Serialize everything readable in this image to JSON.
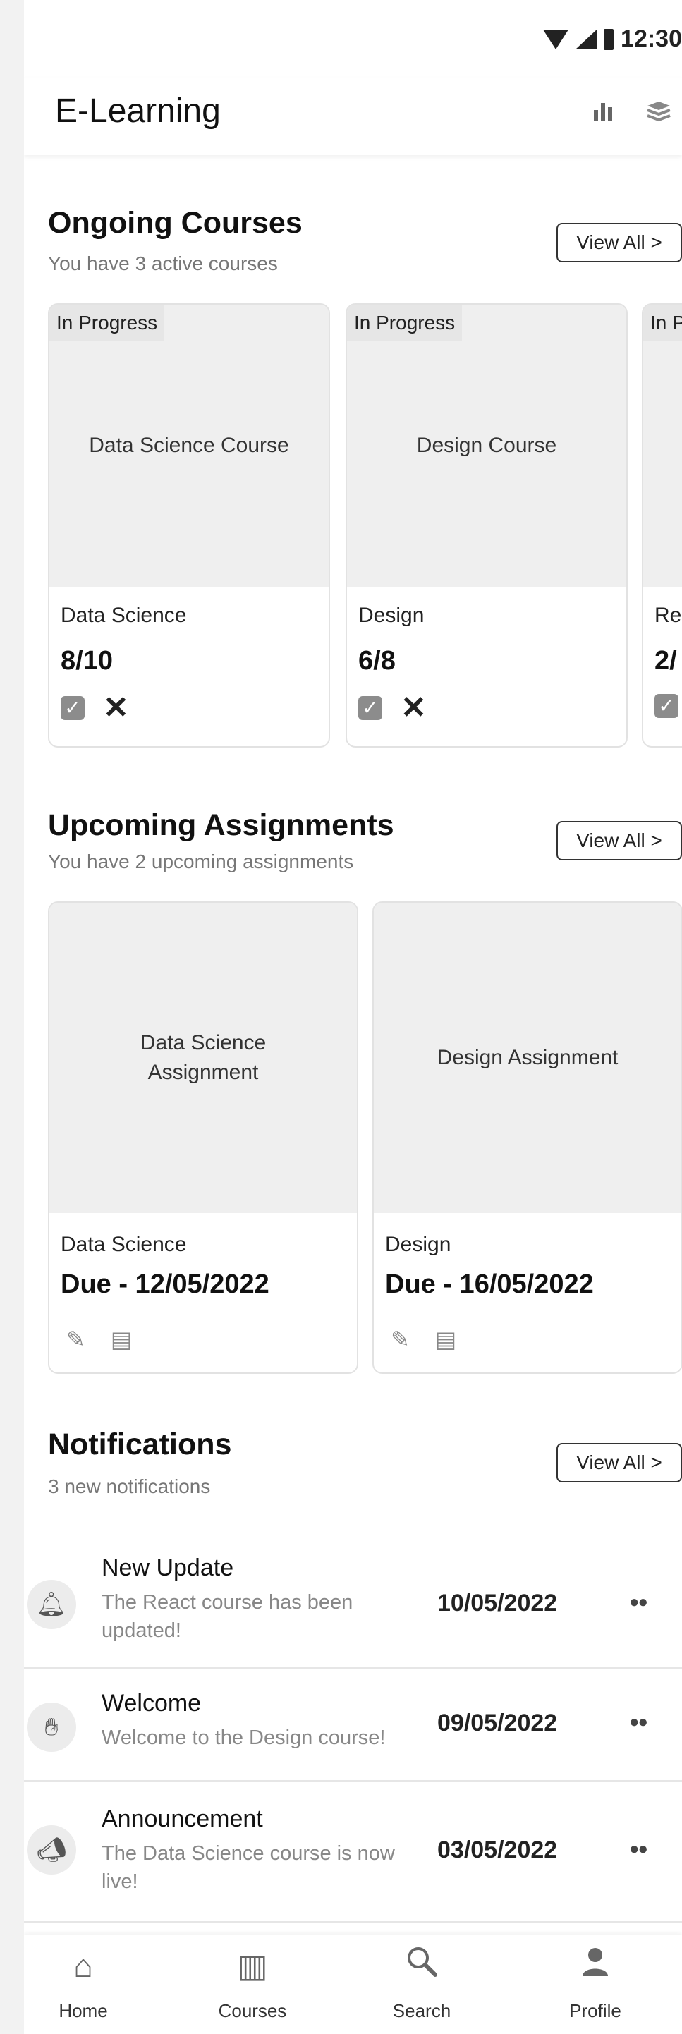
{
  "status_bar": {
    "time": "12:30"
  },
  "app_bar": {
    "title": "E-Learning",
    "chart_icon": "bar-chart-icon",
    "courses_icon": "stack-icon"
  },
  "ongoing": {
    "title": "Ongoing Courses",
    "subtitle": "You have 3 active courses",
    "view_all": "View All >",
    "cards": [
      {
        "badge": "In Progress",
        "image_label": "Data Science Course",
        "category": "Data Science",
        "progress": "8/10"
      },
      {
        "badge": "In Progress",
        "image_label": "Design Course",
        "category": "Design",
        "progress": "6/8"
      },
      {
        "badge": "In P",
        "image_label": "",
        "category": "Re",
        "progress": "2/"
      }
    ],
    "check_icon": "☑",
    "close_icon": "✕"
  },
  "assignments": {
    "title": "Upcoming Assignments",
    "subtitle": "You have 2 upcoming assignments",
    "view_all": "View All >",
    "cards": [
      {
        "image_label": "Data Science Assignment",
        "category": "Data Science",
        "due": "Due - 12/05/2022"
      },
      {
        "image_label": "Design Assignment",
        "category": "Design",
        "due": "Due - 16/05/2022"
      }
    ]
  },
  "notifications": {
    "title": "Notifications",
    "subtitle": "3 new notifications",
    "view_all": "View All >",
    "items": [
      {
        "icon": "bell-icon",
        "title": "New Update",
        "message": "The React course has been updated!",
        "date": "10/05/2022"
      },
      {
        "icon": "waving-hand-icon",
        "title": "Welcome",
        "message": "Welcome to the Design course!",
        "date": "09/05/2022"
      },
      {
        "icon": "megaphone-icon",
        "title": "Announcement",
        "message": "The Data Science course is now live!",
        "date": "03/05/2022"
      }
    ]
  },
  "bottom_nav": {
    "items": [
      {
        "label": "Home",
        "icon": "home-icon"
      },
      {
        "label": "Courses",
        "icon": "book-icon"
      },
      {
        "label": "Search",
        "icon": "search-icon"
      },
      {
        "label": "Profile",
        "icon": "profile-icon"
      }
    ]
  }
}
